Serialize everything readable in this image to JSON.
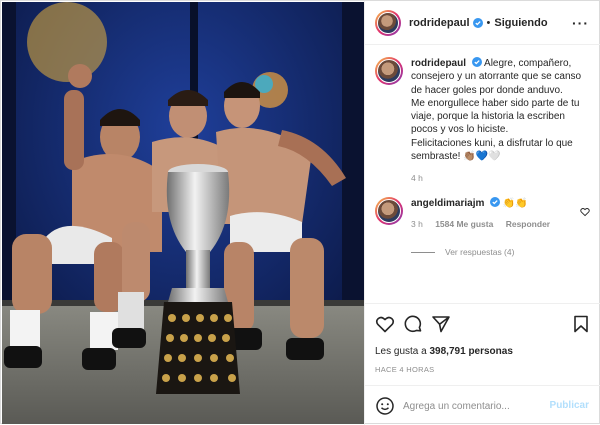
{
  "post": {
    "author": "rodridepaul",
    "follow_state": "Siguiendo",
    "separator": "•",
    "more_icon": "more-options-icon"
  },
  "caption": {
    "author": "rodridepaul",
    "text": "Alegre, compañero, consejero y un atorrante que se canso de hacer goles por donde anduvo.",
    "line2": "Me enorgullece haber sido parte de tu viaje, porque la historia la escriben pocos y vos lo hiciste.",
    "line3": "Felicitaciones kuni, a disfrutar lo que sembraste!",
    "emojis": "👏🏽💙🤍",
    "time": "4 h"
  },
  "comment": {
    "author": "angeldimariajm",
    "text": "👏👏",
    "time": "3 h",
    "likes": "1584 Me gusta",
    "reply": "Responder",
    "view_replies": "Ver respuestas (4)"
  },
  "actions": {
    "like_icon": "heart-icon",
    "comment_icon": "comment-icon",
    "share_icon": "send-icon",
    "save_icon": "bookmark-icon"
  },
  "stats": {
    "likes_label": "Les gusta a",
    "likes_count": "398,791",
    "likes_suffix": "personas",
    "time_ago": "HACE 4 HORAS"
  },
  "composer": {
    "placeholder": "Agrega un comentario...",
    "publish": "Publicar"
  },
  "colors": {
    "verified": "#3897f0",
    "link_disabled": "#b2dffc",
    "muted": "#8e8e8e"
  }
}
